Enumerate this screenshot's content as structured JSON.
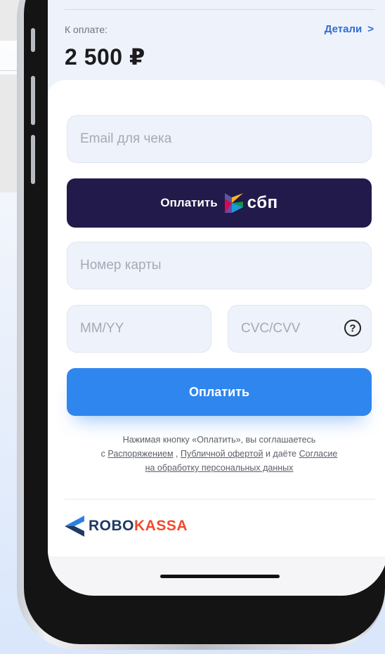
{
  "header": {
    "back_icon": "chevron-left-icon",
    "due_label": "К оплате:",
    "details_label": "Детали",
    "details_chevron": ">",
    "amount": "2 500 ₽"
  },
  "form": {
    "email_placeholder": "Email для чека",
    "sbp_button_label": "Оплатить",
    "sbp_logo_text": "сбп",
    "card_number_placeholder": "Номер карты",
    "expiry_placeholder": "MM/YY",
    "cvc_placeholder": "CVC/CVV",
    "cvc_help": "?",
    "pay_button_label": "Оплатить"
  },
  "consent": {
    "line1": "Нажимая кнопку «Оплатить», вы соглашаетесь",
    "prefix": "с ",
    "link1": "Распоряжением",
    "sep1": " , ",
    "link2": "Публичной офертой",
    "sep2": " и даёте ",
    "link3_part1": "Согласие",
    "link3_part2": "на обработку персональных данных"
  },
  "branding": {
    "logo_part1": "ROBO",
    "logo_part2": "KASSA"
  },
  "colors": {
    "accent": "#2f86ee",
    "sbp_button": "#221a4a",
    "link": "#2f6cd8",
    "robo": "#1f3a63",
    "kassa": "#f04a2c"
  }
}
